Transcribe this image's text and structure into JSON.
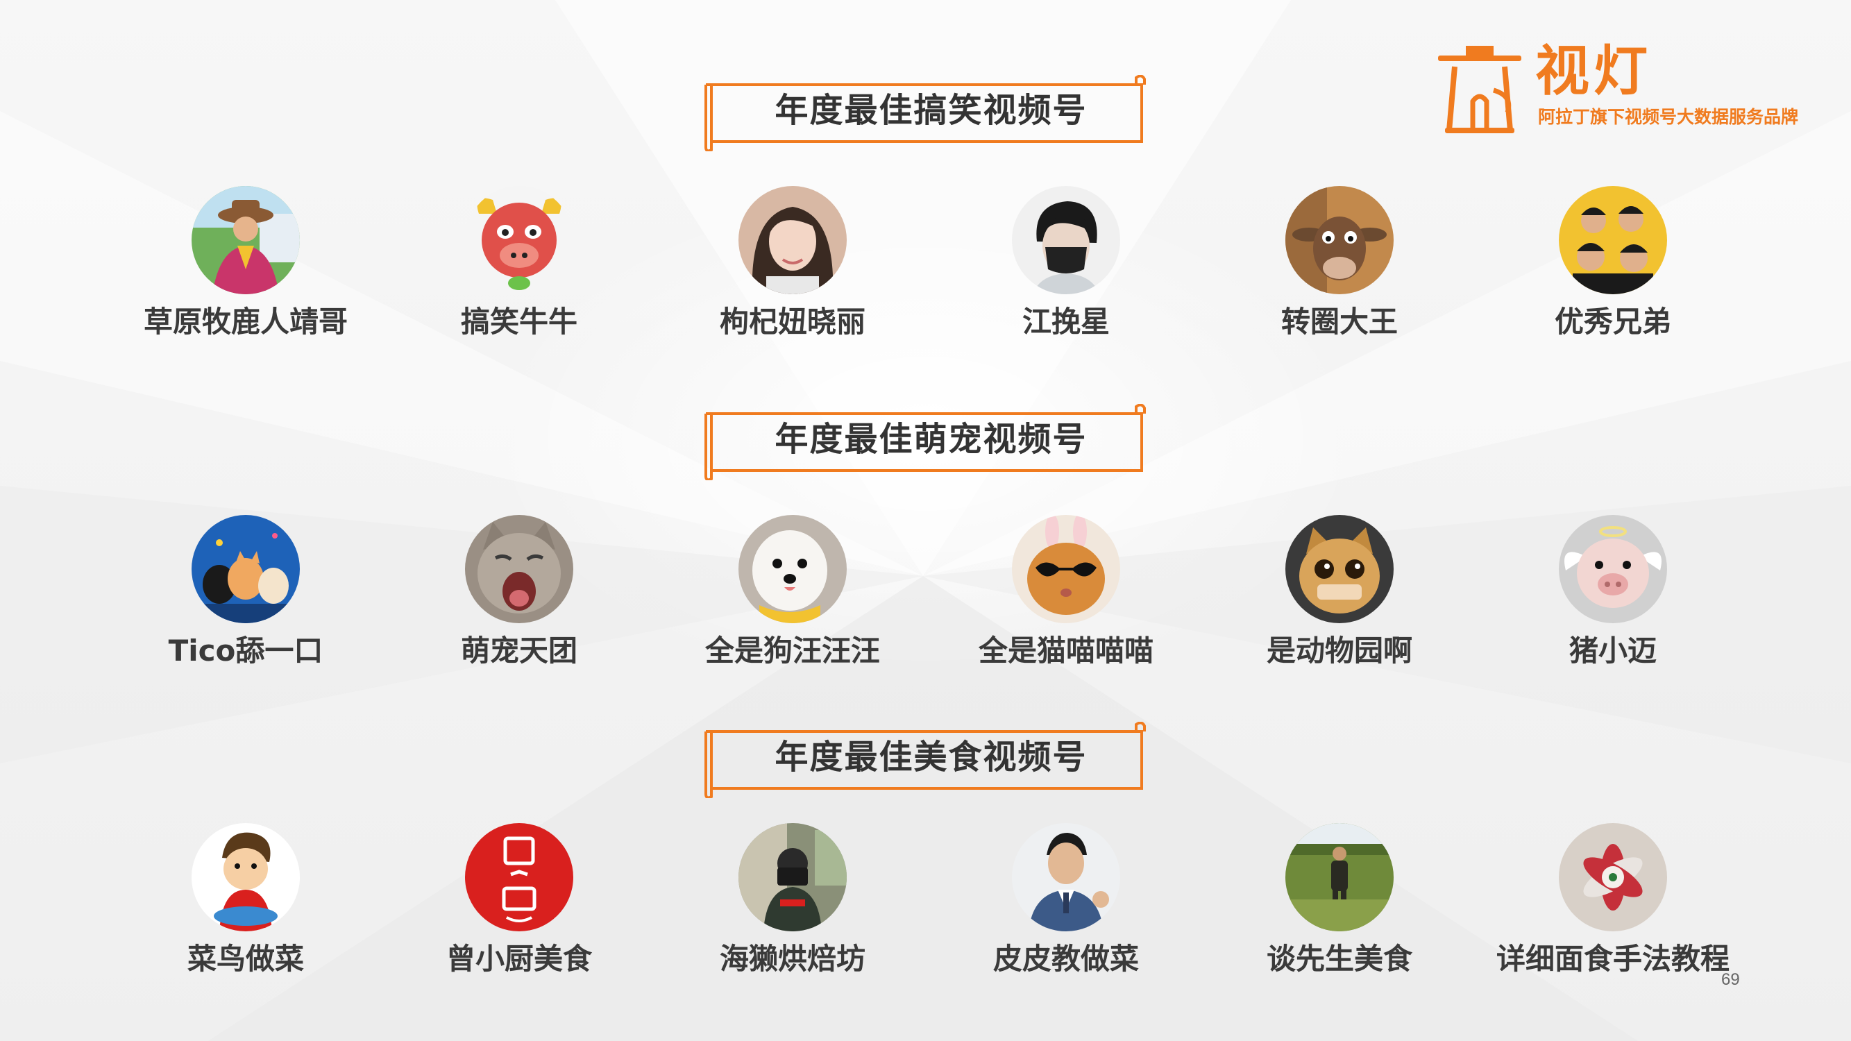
{
  "brand": {
    "name": "视灯",
    "tagline": "阿拉丁旗下视频号大数据服务品牌",
    "accent_color": "#f07b1f"
  },
  "sections": [
    {
      "title": "年度最佳搞笑视频号",
      "items": [
        {
          "name": "草原牧鹿人靖哥",
          "avatar_icon": "person-photo-avatar",
          "color": "#c9356a"
        },
        {
          "name": "搞笑牛牛",
          "avatar_icon": "cartoon-bull-avatar",
          "color": "#e0504a"
        },
        {
          "name": "枸杞妞晓丽",
          "avatar_icon": "person-photo-avatar",
          "color": "#d8b8a4"
        },
        {
          "name": "江挽星",
          "avatar_icon": "person-masked-avatar",
          "color": "#2b2b2b"
        },
        {
          "name": "转圈大王",
          "avatar_icon": "cartoon-cow-avatar",
          "color": "#8a5a3a"
        },
        {
          "name": "优秀兄弟",
          "avatar_icon": "group-photo-avatar",
          "color": "#f2c230"
        }
      ]
    },
    {
      "title": "年度最佳萌宠视频号",
      "items": [
        {
          "name": "Tico舔一口",
          "avatar_icon": "cats-avatar",
          "color": "#1e62b8"
        },
        {
          "name": "萌宠天团",
          "avatar_icon": "cat-yawning-avatar",
          "color": "#9a8f84"
        },
        {
          "name": "全是狗汪汪汪",
          "avatar_icon": "dog-avatar",
          "color": "#e9e4de"
        },
        {
          "name": "全是猫喵喵喵",
          "avatar_icon": "cat-sunglasses-avatar",
          "color": "#d98b3a"
        },
        {
          "name": "是动物园啊",
          "avatar_icon": "cat-cartoon-avatar",
          "color": "#c28a3e"
        },
        {
          "name": "猪小迈",
          "avatar_icon": "pig-avatar",
          "color": "#f0d8d4"
        }
      ]
    },
    {
      "title": "年度最佳美食视频号",
      "items": [
        {
          "name": "菜鸟做菜",
          "avatar_icon": "cartoon-chef-avatar",
          "color": "#ffffff"
        },
        {
          "name": "曾小厨美食",
          "avatar_icon": "red-logo-avatar",
          "color": "#d9201e"
        },
        {
          "name": "海獭烘焙坊",
          "avatar_icon": "person-camera-avatar",
          "color": "#7a8a6a"
        },
        {
          "name": "皮皮教做菜",
          "avatar_icon": "person-suit-avatar",
          "color": "#3c5a88"
        },
        {
          "name": "谈先生美食",
          "avatar_icon": "person-field-avatar",
          "color": "#6f8a3a"
        },
        {
          "name": "详细面食手法教程",
          "avatar_icon": "dough-flower-avatar",
          "color": "#c5303a"
        }
      ]
    }
  ],
  "page_number": "69"
}
